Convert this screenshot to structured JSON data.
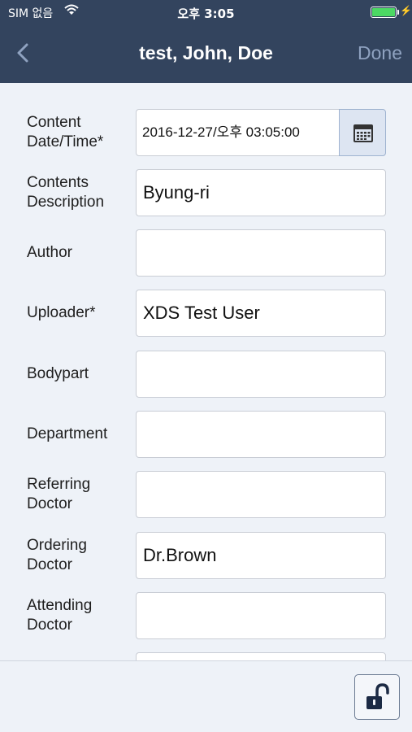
{
  "status_bar": {
    "carrier": "SIM 없음",
    "time": "오후 3:05",
    "battery_level": 1.0,
    "icons": [
      "wifi-icon",
      "battery-icon",
      "charging-bolt-icon"
    ]
  },
  "nav": {
    "back_icon": "chevron-left-icon",
    "title": "test, John, Doe",
    "done_label": "Done"
  },
  "form": {
    "rows": [
      {
        "label": "Content Date/Time*",
        "value": "2016-12-27/오후 03:05:00"
      },
      {
        "label": "Contents Description",
        "value": "Byung-ri"
      },
      {
        "label": "Author",
        "value": ""
      },
      {
        "label": "Uploader*",
        "value": "XDS Test User"
      },
      {
        "label": "Bodypart",
        "value": ""
      },
      {
        "label": "Department",
        "value": ""
      },
      {
        "label": "Referring Doctor",
        "value": ""
      },
      {
        "label": "Ordering Doctor",
        "value": "Dr.Brown"
      },
      {
        "label": "Attending Doctor",
        "value": ""
      },
      {
        "label": "",
        "value": ""
      }
    ],
    "calendar_icon": "calendar-icon"
  },
  "bottom": {
    "lock_icon": "unlock-icon"
  },
  "colors": {
    "nav_background": "#33445e",
    "page_background": "#eef2f8",
    "done_text": "#8fa2c0",
    "battery_fill": "#4cd964"
  }
}
